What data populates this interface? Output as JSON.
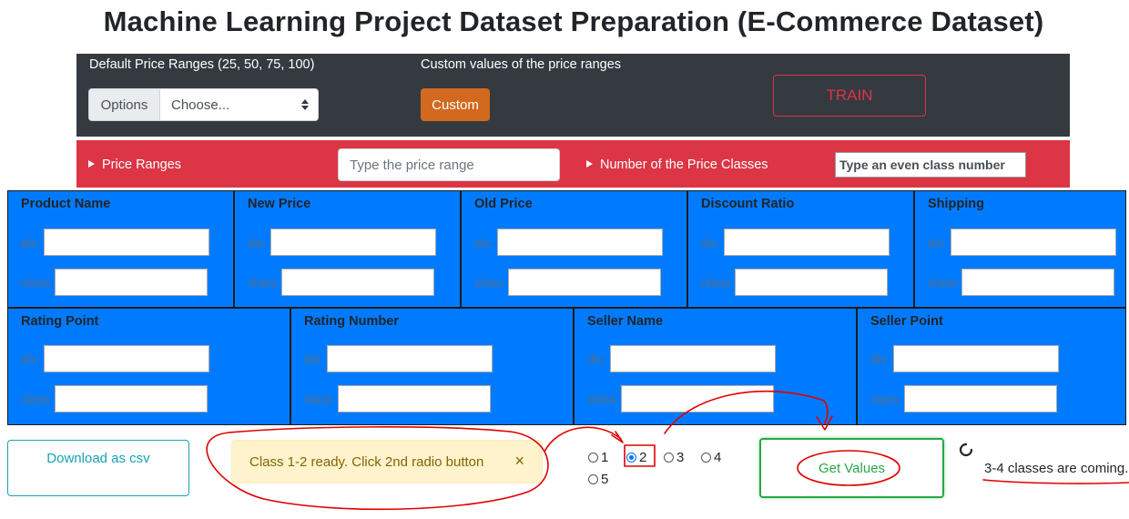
{
  "title": "Machine Learning Project Dataset Preparation (E-Commerce Dataset)",
  "top_panel": {
    "default_label": "Default Price Ranges (25, 50, 75, 100)",
    "options_label": "Options",
    "select_value": "Choose...",
    "custom_label": "Custom values of the price ranges",
    "custom_button": "Custom",
    "train_button": "TRAIN"
  },
  "range_bar": {
    "price_ranges_label": "Price Ranges",
    "price_range_placeholder": "Type the price range",
    "classes_label": "Number of the Price Classes",
    "class_number_placeholder": "Type an even class number"
  },
  "fields_row1": [
    {
      "title": "Product Name",
      "div_label": "div",
      "class_label": "class"
    },
    {
      "title": "New Price",
      "div_label": "div",
      "class_label": "class"
    },
    {
      "title": "Old Price",
      "div_label": "div",
      "class_label": "class"
    },
    {
      "title": "Discount Ratio",
      "div_label": "div",
      "class_label": "class"
    },
    {
      "title": "Shipping",
      "div_label": "div",
      "class_label": "class"
    }
  ],
  "fields_row2": [
    {
      "title": "Rating Point",
      "div_label": "div",
      "class_label": "class"
    },
    {
      "title": "Rating Number",
      "div_label": "div",
      "class_label": "class"
    },
    {
      "title": "Seller Name",
      "div_label": "div",
      "class_label": "class"
    },
    {
      "title": "Seller Point",
      "div_label": "div",
      "class_label": "class"
    }
  ],
  "bottom": {
    "download_button": "Download as csv",
    "alert_text": "Class 1-2 ready. Click 2nd radio button",
    "alert_close": "×",
    "radios": [
      {
        "label": "1",
        "checked": false
      },
      {
        "label": "2",
        "checked": true
      },
      {
        "label": "3",
        "checked": false
      },
      {
        "label": "4",
        "checked": false
      },
      {
        "label": "5",
        "checked": false
      }
    ],
    "get_values_button": "Get Values",
    "status_text": "3-4 classes are coming."
  },
  "colors": {
    "dark_panel": "#343a40",
    "red_bar": "#dc3545",
    "blue_grid": "#007bff",
    "annotation": "#e00000"
  }
}
